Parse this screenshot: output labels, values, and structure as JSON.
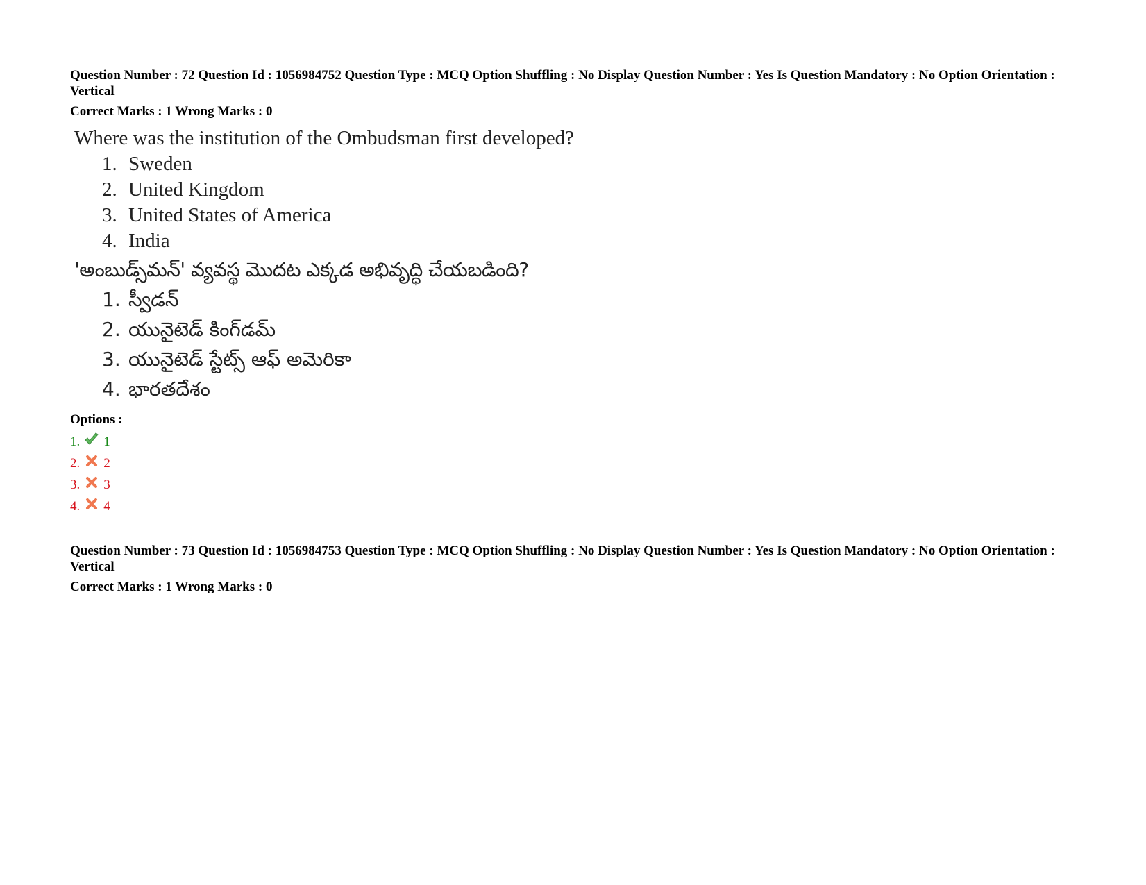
{
  "questions": [
    {
      "meta_line": "Question Number : 72 Question Id : 1056984752 Question Type : MCQ Option Shuffling : No Display Question Number : Yes Is Question Mandatory : No Option Orientation : Vertical",
      "marks_line": "Correct Marks : 1 Wrong Marks : 0",
      "question_en": "Where was the institution of the Ombudsman first developed?",
      "options_en": [
        {
          "num": "1.",
          "text": "Sweden"
        },
        {
          "num": "2.",
          "text": "United Kingdom"
        },
        {
          "num": "3.",
          "text": "United States of America"
        },
        {
          "num": "4.",
          "text": "India"
        }
      ],
      "question_te": "'అంబుడ్స్‌మన్' వ్యవస్థ మొదట ఎక్కడ అభివృద్ధి చేయబడింది?",
      "options_te": [
        {
          "num": "1.",
          "text": "స్వీడన్"
        },
        {
          "num": "2.",
          "text": "యునైటెడ్ కింగ్‌డమ్"
        },
        {
          "num": "3.",
          "text": "యునైటెడ్ స్టేట్స్ ఆఫ్ అమెరికా"
        },
        {
          "num": "4.",
          "text": "భారతదేశం"
        }
      ],
      "options_label": "Options :",
      "answers": [
        {
          "num": "1.",
          "value": "1",
          "status": "correct",
          "icon": "check-icon",
          "color": "#1a8a1a"
        },
        {
          "num": "2.",
          "value": "2",
          "status": "wrong",
          "icon": "cross-icon",
          "color": "#d8141e"
        },
        {
          "num": "3.",
          "value": "3",
          "status": "wrong",
          "icon": "cross-icon",
          "color": "#d8141e"
        },
        {
          "num": "4.",
          "value": "4",
          "status": "wrong",
          "icon": "cross-icon",
          "color": "#d8141e"
        }
      ]
    },
    {
      "meta_line": "Question Number : 73 Question Id : 1056984753 Question Type : MCQ Option Shuffling : No Display Question Number : Yes Is Question Mandatory : No Option Orientation : Vertical",
      "marks_line": "Correct Marks : 1 Wrong Marks : 0"
    }
  ]
}
